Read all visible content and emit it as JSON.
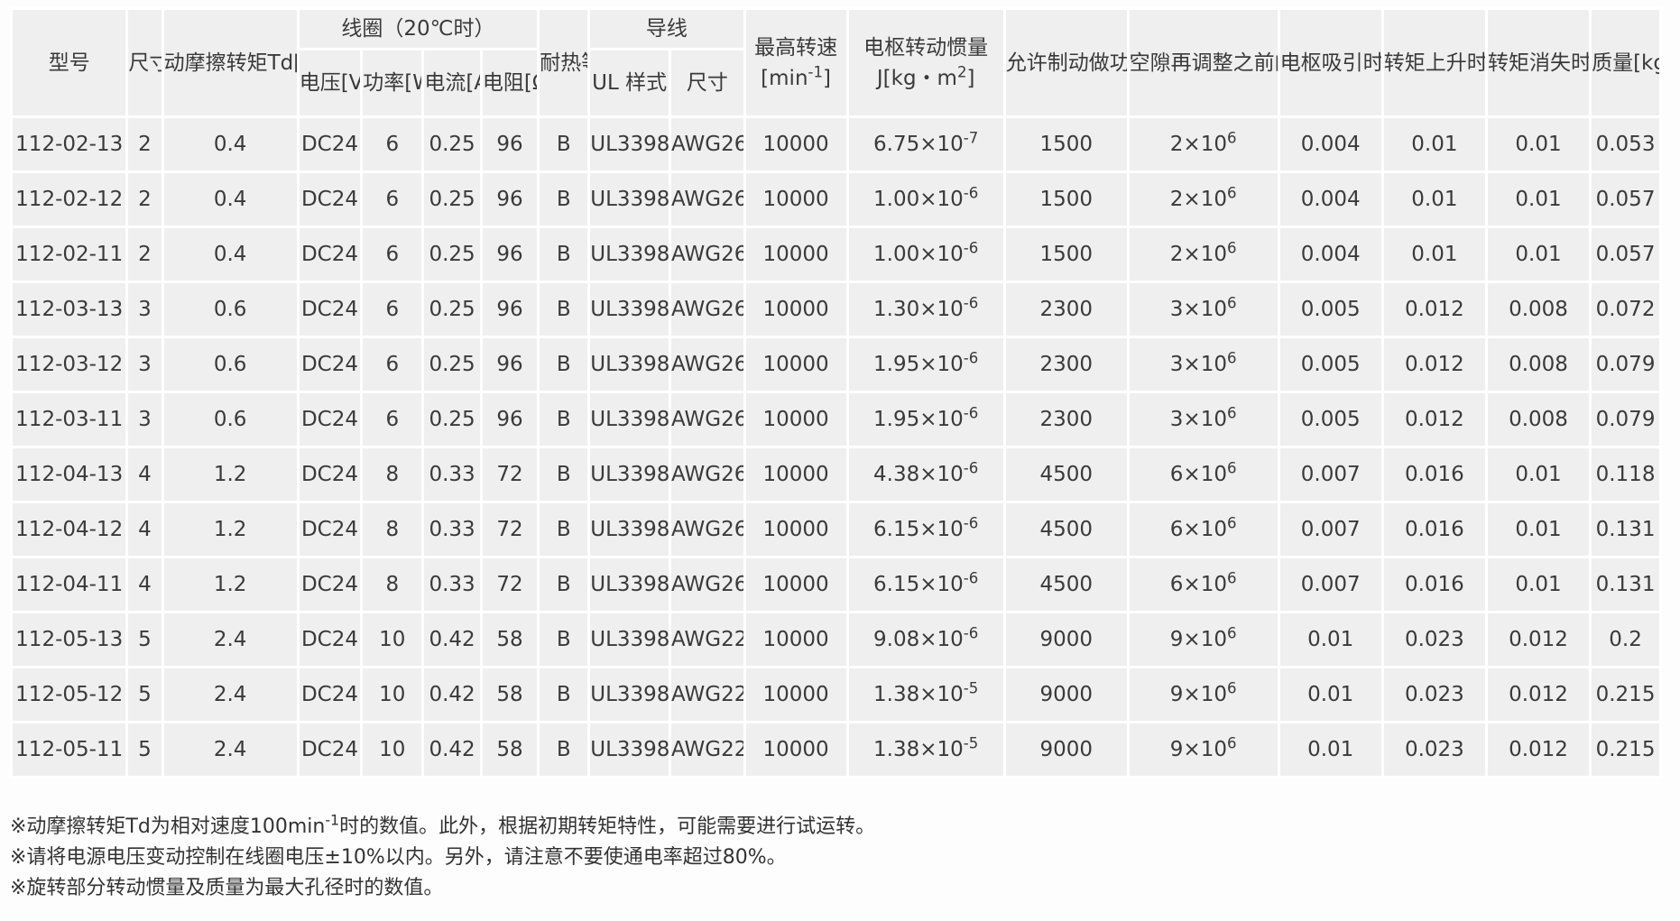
{
  "table": {
    "headers": {
      "model": "型号",
      "size": "尺寸",
      "torque": "动摩擦转矩Td[N•m]",
      "coil_group": "线圈（20℃时）",
      "voltage": "电压[V]",
      "power": "功率[W]",
      "current": "电流[A]",
      "resistance": "电阻[Ω]",
      "heat_class": "耐热等级",
      "lead_group": "导线",
      "ul_style": "UL 样式",
      "lead_size": "尺寸",
      "max_speed_label": "最高转速",
      "max_speed_unit_base": "[min",
      "max_speed_unit_exp": "-1",
      "max_speed_unit_end": "]",
      "inertia_label": "电枢转动惯量",
      "inertia_unit_base": "J[kg・m",
      "inertia_unit_exp": "2",
      "inertia_unit_end": "]",
      "eball": "允许制动做功Ebal[J]",
      "et": "空隙再调整之前的总做功ET[J]",
      "ta": "电枢吸引时间ta[s]",
      "tp": "转矩上升时间tp[s]",
      "td": "转矩消失时间td[s]",
      "mass": "质量[kg]"
    },
    "rows": [
      {
        "model": "112-02-13",
        "size": "2",
        "torque": "0.4",
        "voltage": "DC24",
        "power": "6",
        "current": "0.25",
        "resistance": "96",
        "heat": "B",
        "ul": "UL3398",
        "awg": "AWG26",
        "speed": "10000",
        "inertia_base": "6.75×10",
        "inertia_exp": "-7",
        "eball": "1500",
        "et_base": "2×10",
        "et_exp": "6",
        "ta": "0.004",
        "tp": "0.01",
        "td": "0.01",
        "mass": "0.053"
      },
      {
        "model": "112-02-12",
        "size": "2",
        "torque": "0.4",
        "voltage": "DC24",
        "power": "6",
        "current": "0.25",
        "resistance": "96",
        "heat": "B",
        "ul": "UL3398",
        "awg": "AWG26",
        "speed": "10000",
        "inertia_base": "1.00×10",
        "inertia_exp": "-6",
        "eball": "1500",
        "et_base": "2×10",
        "et_exp": "6",
        "ta": "0.004",
        "tp": "0.01",
        "td": "0.01",
        "mass": "0.057"
      },
      {
        "model": "112-02-11",
        "size": "2",
        "torque": "0.4",
        "voltage": "DC24",
        "power": "6",
        "current": "0.25",
        "resistance": "96",
        "heat": "B",
        "ul": "UL3398",
        "awg": "AWG26",
        "speed": "10000",
        "inertia_base": "1.00×10",
        "inertia_exp": "-6",
        "eball": "1500",
        "et_base": "2×10",
        "et_exp": "6",
        "ta": "0.004",
        "tp": "0.01",
        "td": "0.01",
        "mass": "0.057"
      },
      {
        "model": "112-03-13",
        "size": "3",
        "torque": "0.6",
        "voltage": "DC24",
        "power": "6",
        "current": "0.25",
        "resistance": "96",
        "heat": "B",
        "ul": "UL3398",
        "awg": "AWG26",
        "speed": "10000",
        "inertia_base": "1.30×10",
        "inertia_exp": "-6",
        "eball": "2300",
        "et_base": "3×10",
        "et_exp": "6",
        "ta": "0.005",
        "tp": "0.012",
        "td": "0.008",
        "mass": "0.072"
      },
      {
        "model": "112-03-12",
        "size": "3",
        "torque": "0.6",
        "voltage": "DC24",
        "power": "6",
        "current": "0.25",
        "resistance": "96",
        "heat": "B",
        "ul": "UL3398",
        "awg": "AWG26",
        "speed": "10000",
        "inertia_base": "1.95×10",
        "inertia_exp": "-6",
        "eball": "2300",
        "et_base": "3×10",
        "et_exp": "6",
        "ta": "0.005",
        "tp": "0.012",
        "td": "0.008",
        "mass": "0.079"
      },
      {
        "model": "112-03-11",
        "size": "3",
        "torque": "0.6",
        "voltage": "DC24",
        "power": "6",
        "current": "0.25",
        "resistance": "96",
        "heat": "B",
        "ul": "UL3398",
        "awg": "AWG26",
        "speed": "10000",
        "inertia_base": "1.95×10",
        "inertia_exp": "-6",
        "eball": "2300",
        "et_base": "3×10",
        "et_exp": "6",
        "ta": "0.005",
        "tp": "0.012",
        "td": "0.008",
        "mass": "0.079"
      },
      {
        "model": "112-04-13",
        "size": "4",
        "torque": "1.2",
        "voltage": "DC24",
        "power": "8",
        "current": "0.33",
        "resistance": "72",
        "heat": "B",
        "ul": "UL3398",
        "awg": "AWG26",
        "speed": "10000",
        "inertia_base": "4.38×10",
        "inertia_exp": "-6",
        "eball": "4500",
        "et_base": "6×10",
        "et_exp": "6",
        "ta": "0.007",
        "tp": "0.016",
        "td": "0.01",
        "mass": "0.118"
      },
      {
        "model": "112-04-12",
        "size": "4",
        "torque": "1.2",
        "voltage": "DC24",
        "power": "8",
        "current": "0.33",
        "resistance": "72",
        "heat": "B",
        "ul": "UL3398",
        "awg": "AWG26",
        "speed": "10000",
        "inertia_base": "6.15×10",
        "inertia_exp": "-6",
        "eball": "4500",
        "et_base": "6×10",
        "et_exp": "6",
        "ta": "0.007",
        "tp": "0.016",
        "td": "0.01",
        "mass": "0.131"
      },
      {
        "model": "112-04-11",
        "size": "4",
        "torque": "1.2",
        "voltage": "DC24",
        "power": "8",
        "current": "0.33",
        "resistance": "72",
        "heat": "B",
        "ul": "UL3398",
        "awg": "AWG26",
        "speed": "10000",
        "inertia_base": "6.15×10",
        "inertia_exp": "-6",
        "eball": "4500",
        "et_base": "6×10",
        "et_exp": "6",
        "ta": "0.007",
        "tp": "0.016",
        "td": "0.01",
        "mass": "0.131"
      },
      {
        "model": "112-05-13",
        "size": "5",
        "torque": "2.4",
        "voltage": "DC24",
        "power": "10",
        "current": "0.42",
        "resistance": "58",
        "heat": "B",
        "ul": "UL3398",
        "awg": "AWG22",
        "speed": "10000",
        "inertia_base": "9.08×10",
        "inertia_exp": "-6",
        "eball": "9000",
        "et_base": "9×10",
        "et_exp": "6",
        "ta": "0.01",
        "tp": "0.023",
        "td": "0.012",
        "mass": "0.2"
      },
      {
        "model": "112-05-12",
        "size": "5",
        "torque": "2.4",
        "voltage": "DC24",
        "power": "10",
        "current": "0.42",
        "resistance": "58",
        "heat": "B",
        "ul": "UL3398",
        "awg": "AWG22",
        "speed": "10000",
        "inertia_base": "1.38×10",
        "inertia_exp": "-5",
        "eball": "9000",
        "et_base": "9×10",
        "et_exp": "6",
        "ta": "0.01",
        "tp": "0.023",
        "td": "0.012",
        "mass": "0.215"
      },
      {
        "model": "112-05-11",
        "size": "5",
        "torque": "2.4",
        "voltage": "DC24",
        "power": "10",
        "current": "0.42",
        "resistance": "58",
        "heat": "B",
        "ul": "UL3398",
        "awg": "AWG22",
        "speed": "10000",
        "inertia_base": "1.38×10",
        "inertia_exp": "-5",
        "eball": "9000",
        "et_base": "9×10",
        "et_exp": "6",
        "ta": "0.01",
        "tp": "0.023",
        "td": "0.012",
        "mass": "0.215"
      }
    ]
  },
  "notes": {
    "note1_before": "※动摩擦转矩Td为相对速度100min",
    "note1_exp": "-1",
    "note1_after": "时的数值。此外，根据初期转矩特性，可能需要进行试运转。",
    "note2": "※请将电源电压变动控制在线圈电压±10%以内。另外，请注意不要使通电率超过80%。",
    "note3": "※旋转部分转动惯量及质量为最大孔径时的数值。"
  }
}
